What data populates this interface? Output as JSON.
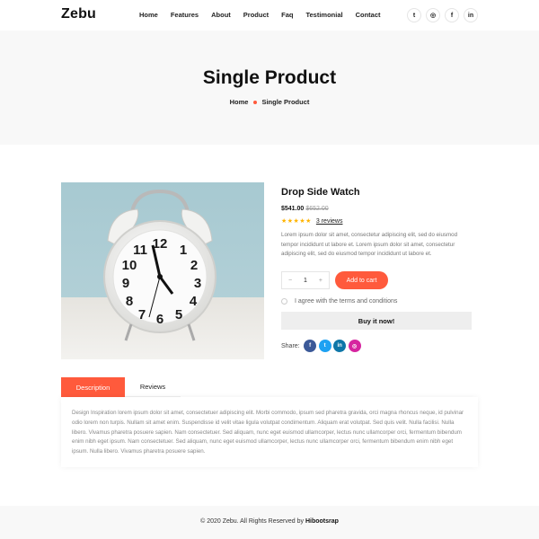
{
  "header": {
    "logo": "Zebu",
    "nav": [
      "Home",
      "Features",
      "About",
      "Product",
      "Faq",
      "Testimonial",
      "Contact"
    ],
    "social_icons": [
      "twitter-icon",
      "instagram-icon",
      "facebook-icon",
      "linkedin-icon"
    ],
    "social_glyphs": [
      "t",
      "◎",
      "f",
      "in"
    ]
  },
  "hero": {
    "title": "Single Product",
    "breadcrumb": [
      "Home",
      "Single Product"
    ]
  },
  "product": {
    "title": "Drop Side Watch",
    "price": "$541.00",
    "old_price": "$652.00",
    "rating": 5,
    "stars": "★★★★★",
    "reviews": "3 reviews",
    "description": "Lorem ipsum dolor sit amet, consectetur adipiscing elit, sed do eiusmod tempor incididunt ut labore et. Lorem ipsum dolor sit amet, consectetur adipiscing elit, sed do eiusmod tempor incididunt ut labore et.",
    "quantity": "1",
    "minus": "−",
    "plus": "+",
    "add_to_cart": "Add to cart",
    "terms": "I agree with the terms and conditions",
    "buy_now": "Buy it now!",
    "share_label": "Share:",
    "share_icons": [
      "facebook-icon",
      "twitter-icon",
      "linkedin-icon",
      "instagram-icon"
    ],
    "share_glyphs": [
      "f",
      "t",
      "in",
      "◎"
    ],
    "share_colors": [
      "#3b5998",
      "#1da1f2",
      "#0e76a8",
      "#d6249f"
    ]
  },
  "tabs": {
    "items": [
      "Description",
      "Reviews"
    ],
    "active": "Description",
    "description_text": "Design Inspiration lorem ipsum dolor sit amet, consectetuer adipiscing elit. Morbi commodo, ipsum sed pharetra gravida, orci magna rhoncus neque, id pulvinar odio lorem non turpis. Nullam sit amet enim. Suspendisse id velit vitae ligula volutpat condimentum. Aliquam erat volutpat. Sed quis velit. Nulla facilisi. Nulla libero. Vivamus pharetra posuere sapien. Nam consectetuer. Sed aliquam, nunc eget euismod ullamcorper, lectus nunc ullamcorper orci, fermentum bibendum enim nibh eget ipsum. Nam consectetuer. Sed aliquam, nunc eget euismod ullamcorper, lectus nunc ullamcorper orci, fermentum bibendum enim nibh eget ipsum. Nulla libero. Vivamus pharetra posuere sapien."
  },
  "footer": {
    "copyright": "© 2020 Zebu. All Rights Reserved by",
    "brand": "Hibootsrap"
  },
  "colors": {
    "accent": "#ff5a3c",
    "star": "#ffb400",
    "hero_bg": "#f8f8f8"
  }
}
